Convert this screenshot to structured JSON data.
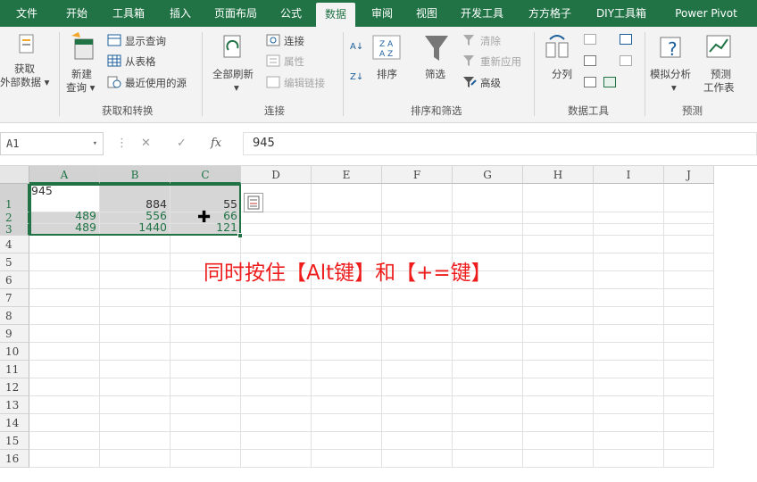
{
  "tabs": [
    {
      "label": "文件",
      "active": false
    },
    {
      "label": "开始",
      "active": false
    },
    {
      "label": "工具箱",
      "active": false
    },
    {
      "label": "插入",
      "active": false
    },
    {
      "label": "页面布局",
      "active": false
    },
    {
      "label": "公式",
      "active": false
    },
    {
      "label": "数据",
      "active": true
    },
    {
      "label": "审阅",
      "active": false
    },
    {
      "label": "视图",
      "active": false
    },
    {
      "label": "开发工具",
      "active": false
    },
    {
      "label": "方方格子",
      "active": false
    },
    {
      "label": "DIY工具箱",
      "active": false
    },
    {
      "label": "Power Pivot",
      "active": false
    }
  ],
  "ribbon": {
    "get_external_data": {
      "line1": "获取",
      "line2": "外部数据 ▾"
    },
    "new_query": {
      "line1": "新建",
      "line2": "查询 ▾"
    },
    "show_queries": "显示查询",
    "from_table": "从表格",
    "recent_sources": "最近使用的源",
    "group_get_transform": "获取和转换",
    "refresh_all": {
      "line1": "全部刷新",
      "line2": "▾"
    },
    "connections": "连接",
    "properties": "属性",
    "edit_links": "编辑链接",
    "group_connections": "连接",
    "sort_label": "排序",
    "filter_label": "筛选",
    "clear": "清除",
    "reapply": "重新应用",
    "advanced": "高级",
    "group_sort_filter": "排序和筛选",
    "text_to_columns": "分列",
    "group_data_tools": "数据工具",
    "what_if": {
      "line1": "模拟分析",
      "line2": "▾"
    },
    "forecast_sheet": {
      "line1": "预测",
      "line2": "工作表"
    },
    "group_forecast": "预测"
  },
  "formula_bar": {
    "name_box": "A1",
    "name_box_arrow": "▾",
    "sep": "⋮",
    "cancel": "✕",
    "enter": "✓",
    "fx": "fx",
    "content": "945"
  },
  "columns": [
    "A",
    "B",
    "C",
    "D",
    "E",
    "F",
    "G",
    "H",
    "I",
    "J"
  ],
  "selected_columns": [
    "A",
    "B",
    "C"
  ],
  "rows": [
    "1",
    "2",
    "3",
    "4",
    "5",
    "6",
    "7",
    "8",
    "9",
    "10",
    "11",
    "12",
    "13",
    "14",
    "15",
    "16"
  ],
  "selected_rows": [
    "1",
    "2",
    "3"
  ],
  "cells": [
    [
      "945",
      "884",
      "55"
    ],
    [
      "489",
      "556",
      "66"
    ],
    [
      "489",
      "1440",
      "121"
    ]
  ],
  "annotation": "同时按住【Alt键】和【+=键】",
  "colors": {
    "accent": "#217346",
    "annotation": "#ee1c1c",
    "selection_shade": "#d6d6d6"
  }
}
